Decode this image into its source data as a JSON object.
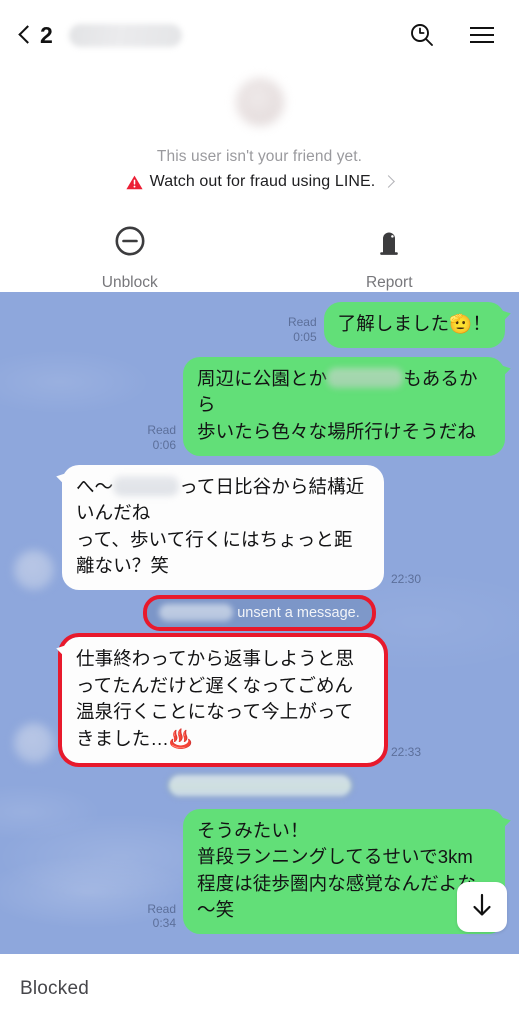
{
  "app": "LINE",
  "header": {
    "back_count": "2",
    "title_redacted": true,
    "title": "",
    "search_icon": "search-clock-icon",
    "menu_icon": "hamburger-menu-icon"
  },
  "not_friend_panel": {
    "avatar_redacted": true,
    "note": "This user isn't your friend yet.",
    "fraud_warning": "Watch out for fraud using LINE.",
    "fraud_chevron": "›",
    "warning_color": "#ec1f35",
    "actions": [
      {
        "label": "Unblock",
        "icon": "block-minus-circle-icon"
      },
      {
        "label": "Report",
        "icon": "report-tombstone-icon"
      }
    ]
  },
  "chat": {
    "background_color": "#8ea7dc",
    "outgoing_bubble_color": "#62df78",
    "incoming_bubble_color": "#fdfdfd",
    "highlight_color": "#e8192c",
    "messages": [
      {
        "id": "m1",
        "side": "outgoing",
        "status": "Read",
        "time": "0:05",
        "text": "了解しました🫡！",
        "highlighted": false
      },
      {
        "id": "m2",
        "side": "outgoing",
        "status": "Read",
        "time": "0:06",
        "text_before": "周辺に公園とか",
        "redacted": true,
        "text_after": "もあるから\n歩いたら色々な場所行けそうだね",
        "highlighted": false
      },
      {
        "id": "m3",
        "side": "incoming",
        "status": "",
        "time": "22:30",
        "text_before": "へ～",
        "redacted": true,
        "text_after": "って日比谷から結構近いんだね\nって、歩いて行くにはちょっと距離ない？笑",
        "highlighted": false
      },
      {
        "id": "m4",
        "side": "system",
        "type": "unsent",
        "name_redacted": true,
        "text": "unsent a message.",
        "highlighted": true
      },
      {
        "id": "m5",
        "side": "incoming",
        "status": "",
        "time": "22:33",
        "text": "仕事終わってから返事しようと思ってたんだけど遅くなってごめん\n温泉行くことになって今上がってきました…♨️",
        "highlighted": true
      },
      {
        "id": "m6",
        "side": "system",
        "type": "redacted-pill",
        "text": "",
        "highlighted": false
      },
      {
        "id": "m7",
        "side": "outgoing",
        "status": "Read",
        "time": "0:34",
        "text": "そうみたい！\n普段ランニングしてるせいで3km程度は徒歩圏内な感覚なんだよな～笑",
        "highlighted": false
      }
    ],
    "scroll_button_icon": "arrow-down-icon"
  },
  "footer": {
    "status": "Blocked"
  }
}
